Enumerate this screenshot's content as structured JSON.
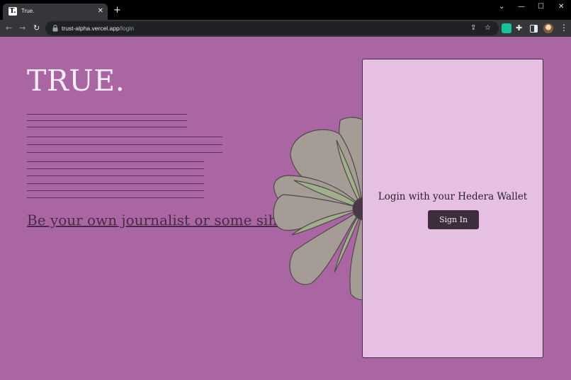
{
  "browser": {
    "tab_favicon": "T.",
    "tab_title": "True.",
    "tab_close": "✕",
    "new_tab": "+",
    "window_controls": {
      "chevron": "⌄",
      "minimize": "—",
      "maximize": "☐",
      "close": "✕"
    },
    "nav": {
      "back": "←",
      "forward": "→",
      "reload": "↻"
    },
    "url_host": "trust-alpha.vercel.app",
    "url_path": "/login",
    "share_icon": "⇪",
    "star_icon": "☆",
    "puzzle_icon": "✚",
    "menu_icon": "⋮"
  },
  "page": {
    "logo": "TRUE.",
    "tagline": "Be your own journalist or some siht"
  },
  "login": {
    "title": "Login with your Hedera Wallet",
    "button": "Sign In"
  },
  "colors": {
    "background": "#a966a2",
    "card": "#e5c0e2",
    "button": "#3e2e3d",
    "petal": "#a49c95",
    "leaf": "#9fb08a"
  }
}
